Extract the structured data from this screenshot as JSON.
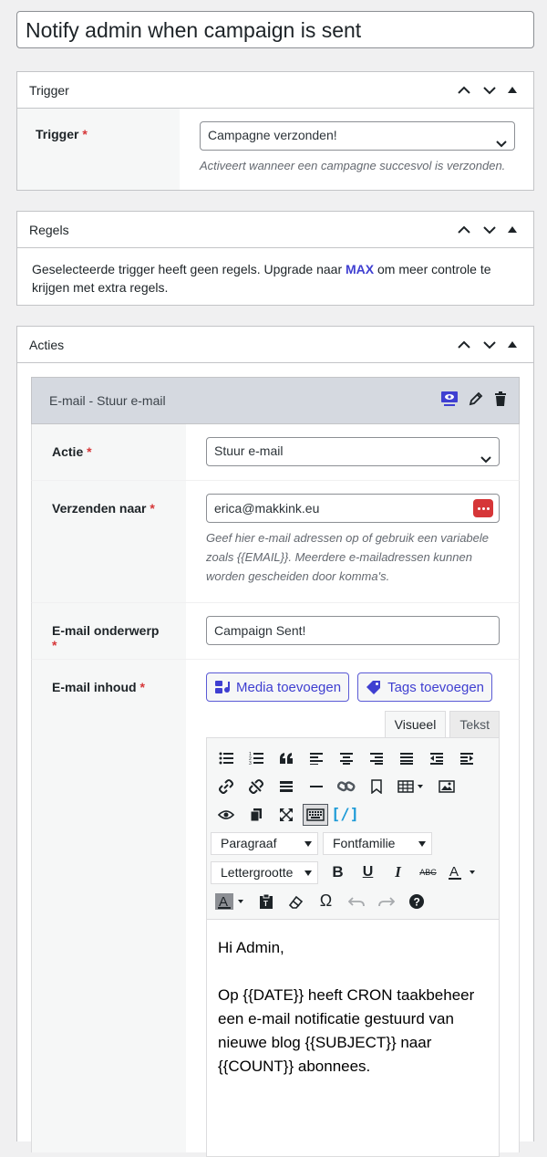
{
  "post_title": "Notify admin when campaign is sent",
  "trigger_box": {
    "title": "Trigger",
    "field_label": "Trigger",
    "required_mark": "*",
    "selected": "Campagne verzonden!",
    "description": "Activeert wanneer een campagne succesvol is verzonden."
  },
  "rules_box": {
    "title": "Regels",
    "text_before": "Geselecteerde trigger heeft geen regels. Upgrade naar ",
    "link": "MAX",
    "text_after": " om meer controle te krijgen met extra regels."
  },
  "actions_box": {
    "title": "Acties",
    "action": {
      "title": "E-mail - Stuur e-mail",
      "icons": [
        "preview-icon",
        "pencil-icon",
        "trash-icon"
      ],
      "fields": {
        "action_label": "Actie",
        "action_value": "Stuur e-mail",
        "send_to_label": "Verzenden naar",
        "send_to_value": "erica@makkink.eu",
        "send_to_help": "Geef hier e-mail adressen op of gebruik een variabele zoals {{EMAIL}}. Meerdere e-mailadressen kunnen worden gescheiden door komma's.",
        "subject_label": "E-mail onderwerp",
        "subject_value": "Campaign Sent!",
        "content_label": "E-mail inhoud"
      },
      "editor": {
        "add_media": "Media toevoegen",
        "add_tags": "Tags toevoegen",
        "tab_visual": "Visueel",
        "tab_text": "Tekst",
        "format_select": "Paragraaf",
        "font_family_select": "Fontfamilie",
        "font_size_select": "Lettergrootte",
        "content_p1": "Hi Admin,",
        "content_p2": "Op {{DATE}} heeft CRON taakbeheer een e-mail notificatie gestuurd van nieuwe blog {{SUBJECT}} naar {{COUNT}} abonnees."
      }
    }
  },
  "colors": {
    "accent": "#3f3fd1",
    "required": "#d63638",
    "action_header_bg": "#d5d9e0",
    "dots_button": "#d63638"
  }
}
